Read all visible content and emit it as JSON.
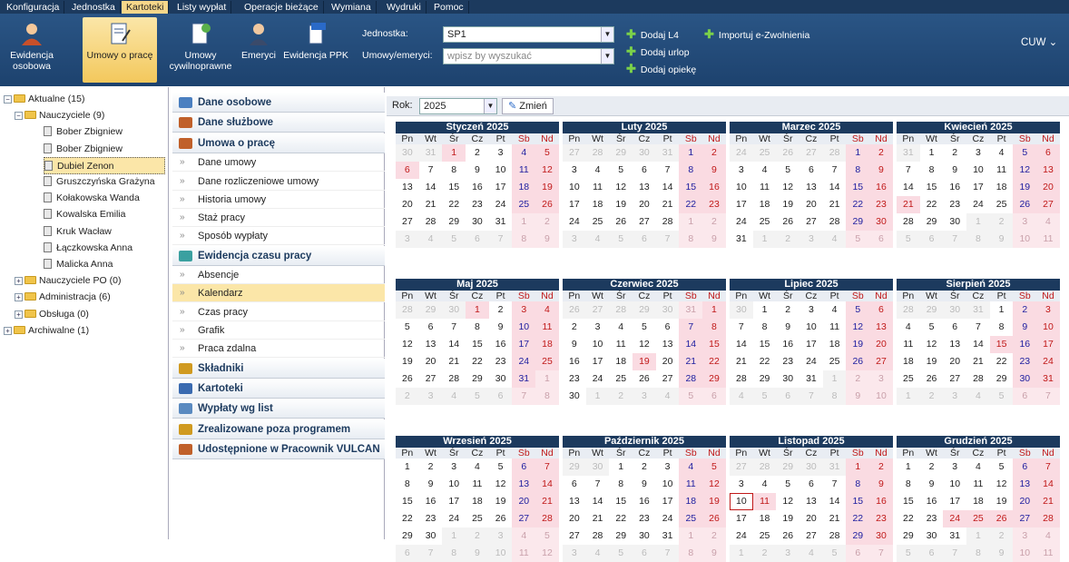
{
  "menu": [
    "Konfiguracja",
    "Jednostka",
    "Kartoteki",
    "Listy wypłat",
    "Operacje bieżące",
    "Wymiana",
    "Wydruki",
    "Pomoc"
  ],
  "menu_active": "Kartoteki",
  "toolbar": {
    "buttons": [
      {
        "label": "Ewidencja\nosobowa",
        "icon": "person-icon"
      },
      {
        "label": "Umowy o pracę",
        "icon": "contract-icon"
      },
      {
        "label": "Umowy\ncywilnoprawne",
        "icon": "civil-contract-icon"
      },
      {
        "label": "Emeryci",
        "icon": "retiree-icon"
      },
      {
        "label": "Ewidencja PPK",
        "icon": "ppk-icon"
      }
    ],
    "jednostka_label": "Jednostka:",
    "jednostka_value": "SP1",
    "umowy_label": "Umowy/emeryci:",
    "umowy_placeholder": "wpisz by wyszukać",
    "actions": [
      "Dodaj L4",
      "Dodaj urlop",
      "Dodaj opiekę",
      "Importuj e-Zwolnienia"
    ],
    "user_menu": "CUW"
  },
  "tree": [
    {
      "label": "Aktualne (15)",
      "type": "folder",
      "level": 0,
      "expander": "-"
    },
    {
      "label": "Nauczyciele (9)",
      "type": "folder",
      "level": 1,
      "expander": "-"
    },
    {
      "label": "Bober Zbigniew",
      "type": "doc",
      "level": 2
    },
    {
      "label": "Bober Zbigniew",
      "type": "doc",
      "level": 2
    },
    {
      "label": "Dubiel Zenon",
      "type": "doc",
      "level": 2,
      "selected": true
    },
    {
      "label": "Gruszczyńska Grażyna",
      "type": "doc",
      "level": 2
    },
    {
      "label": "Kołakowska Wanda",
      "type": "doc",
      "level": 2
    },
    {
      "label": "Kowalska Emilia",
      "type": "doc",
      "level": 2
    },
    {
      "label": "Kruk Wacław",
      "type": "doc",
      "level": 2
    },
    {
      "label": "Łączkowska Anna",
      "type": "doc",
      "level": 2
    },
    {
      "label": "Malicka Anna",
      "type": "doc",
      "level": 2
    },
    {
      "label": "Nauczyciele PO (0)",
      "type": "folder",
      "level": 1,
      "expander": "+"
    },
    {
      "label": "Administracja (6)",
      "type": "folder",
      "level": 1,
      "expander": "+"
    },
    {
      "label": "Obsługa (0)",
      "type": "folder",
      "level": 1,
      "expander": "+"
    },
    {
      "label": "Archiwalne (1)",
      "type": "folder",
      "level": 0,
      "expander": "+"
    }
  ],
  "nav": [
    {
      "label": "Dane osobowe",
      "kind": "section",
      "icon": "person-icon",
      "color": "#4a7fc0"
    },
    {
      "label": "Dane służbowe",
      "kind": "section",
      "icon": "briefcase-icon",
      "color": "#c0602a"
    },
    {
      "label": "Umowa o pracę",
      "kind": "section",
      "icon": "handshake-icon",
      "color": "#c0602a"
    },
    {
      "label": "Dane umowy",
      "kind": "item"
    },
    {
      "label": "Dane rozliczeniowe umowy",
      "kind": "item"
    },
    {
      "label": "Historia umowy",
      "kind": "item"
    },
    {
      "label": "Staż pracy",
      "kind": "item"
    },
    {
      "label": "Sposób wypłaty",
      "kind": "item"
    },
    {
      "label": "Ewidencja czasu pracy",
      "kind": "section",
      "icon": "clock-icon",
      "color": "#3aa0a0"
    },
    {
      "label": "Absencje",
      "kind": "item"
    },
    {
      "label": "Kalendarz",
      "kind": "item",
      "active": true
    },
    {
      "label": "Czas pracy",
      "kind": "item"
    },
    {
      "label": "Grafik",
      "kind": "item"
    },
    {
      "label": "Praca zdalna",
      "kind": "item"
    },
    {
      "label": "Składniki",
      "kind": "section",
      "icon": "components-icon",
      "color": "#d09a20"
    },
    {
      "label": "Kartoteki",
      "kind": "section",
      "icon": "card-icon",
      "color": "#3a6ab0"
    },
    {
      "label": "Wypłaty wg list",
      "kind": "section",
      "icon": "payout-icon",
      "color": "#5a8ac0"
    },
    {
      "label": "Zrealizowane poza programem",
      "kind": "section",
      "icon": "external-icon",
      "color": "#d09a20"
    },
    {
      "label": "Udostępnione w Pracownik VULCAN",
      "kind": "section",
      "icon": "share-icon",
      "color": "#c0602a"
    }
  ],
  "year": {
    "label": "Rok:",
    "value": "2025",
    "change_button": "Zmień"
  },
  "weekdays": [
    "Pn",
    "Wt",
    "Śr",
    "Cz",
    "Pt",
    "Sb",
    "Nd"
  ],
  "months": [
    {
      "name": "Styczeń 2025",
      "weeks": [
        [
          "30",
          "31",
          "1",
          "2",
          "3",
          "4",
          "5"
        ],
        [
          "6",
          "7",
          "8",
          "9",
          "10",
          "11",
          "12"
        ],
        [
          "13",
          "14",
          "15",
          "16",
          "17",
          "18",
          "19"
        ],
        [
          "20",
          "21",
          "22",
          "23",
          "24",
          "25",
          "26"
        ],
        [
          "27",
          "28",
          "29",
          "30",
          "31",
          "1",
          "2"
        ],
        [
          "3",
          "4",
          "5",
          "6",
          "7",
          "8",
          "9"
        ]
      ]
    },
    {
      "name": "Luty 2025",
      "weeks": [
        [
          "27",
          "28",
          "29",
          "30",
          "31",
          "1",
          "2"
        ],
        [
          "3",
          "4",
          "5",
          "6",
          "7",
          "8",
          "9"
        ],
        [
          "10",
          "11",
          "12",
          "13",
          "14",
          "15",
          "16"
        ],
        [
          "17",
          "18",
          "19",
          "20",
          "21",
          "22",
          "23"
        ],
        [
          "24",
          "25",
          "26",
          "27",
          "28",
          "1",
          "2"
        ],
        [
          "3",
          "4",
          "5",
          "6",
          "7",
          "8",
          "9"
        ]
      ]
    },
    {
      "name": "Marzec 2025",
      "weeks": [
        [
          "24",
          "25",
          "26",
          "27",
          "28",
          "1",
          "2"
        ],
        [
          "3",
          "4",
          "5",
          "6",
          "7",
          "8",
          "9"
        ],
        [
          "10",
          "11",
          "12",
          "13",
          "14",
          "15",
          "16"
        ],
        [
          "17",
          "18",
          "19",
          "20",
          "21",
          "22",
          "23"
        ],
        [
          "24",
          "25",
          "26",
          "27",
          "28",
          "29",
          "30"
        ],
        [
          "31",
          "1",
          "2",
          "3",
          "4",
          "5",
          "6"
        ]
      ]
    },
    {
      "name": "Kwiecień 2025",
      "weeks": [
        [
          "31",
          "1",
          "2",
          "3",
          "4",
          "5",
          "6"
        ],
        [
          "7",
          "8",
          "9",
          "10",
          "11",
          "12",
          "13"
        ],
        [
          "14",
          "15",
          "16",
          "17",
          "18",
          "19",
          "20"
        ],
        [
          "21",
          "22",
          "23",
          "24",
          "25",
          "26",
          "27"
        ],
        [
          "28",
          "29",
          "30",
          "1",
          "2",
          "3",
          "4"
        ],
        [
          "5",
          "6",
          "7",
          "8",
          "9",
          "10",
          "11"
        ]
      ]
    },
    {
      "name": "Maj 2025",
      "weeks": [
        [
          "28",
          "29",
          "30",
          "1",
          "2",
          "3",
          "4"
        ],
        [
          "5",
          "6",
          "7",
          "8",
          "9",
          "10",
          "11"
        ],
        [
          "12",
          "13",
          "14",
          "15",
          "16",
          "17",
          "18"
        ],
        [
          "19",
          "20",
          "21",
          "22",
          "23",
          "24",
          "25"
        ],
        [
          "26",
          "27",
          "28",
          "29",
          "30",
          "31",
          "1"
        ],
        [
          "2",
          "3",
          "4",
          "5",
          "6",
          "7",
          "8"
        ]
      ]
    },
    {
      "name": "Czerwiec 2025",
      "weeks": [
        [
          "26",
          "27",
          "28",
          "29",
          "30",
          "31",
          "1"
        ],
        [
          "2",
          "3",
          "4",
          "5",
          "6",
          "7",
          "8"
        ],
        [
          "9",
          "10",
          "11",
          "12",
          "13",
          "14",
          "15"
        ],
        [
          "16",
          "17",
          "18",
          "19",
          "20",
          "21",
          "22"
        ],
        [
          "23",
          "24",
          "25",
          "26",
          "27",
          "28",
          "29"
        ],
        [
          "30",
          "1",
          "2",
          "3",
          "4",
          "5",
          "6"
        ]
      ]
    },
    {
      "name": "Lipiec 2025",
      "weeks": [
        [
          "30",
          "1",
          "2",
          "3",
          "4",
          "5",
          "6"
        ],
        [
          "7",
          "8",
          "9",
          "10",
          "11",
          "12",
          "13"
        ],
        [
          "14",
          "15",
          "16",
          "17",
          "18",
          "19",
          "20"
        ],
        [
          "21",
          "22",
          "23",
          "24",
          "25",
          "26",
          "27"
        ],
        [
          "28",
          "29",
          "30",
          "31",
          "1",
          "2",
          "3"
        ],
        [
          "4",
          "5",
          "6",
          "7",
          "8",
          "9",
          "10"
        ]
      ]
    },
    {
      "name": "Sierpień 2025",
      "weeks": [
        [
          "28",
          "29",
          "30",
          "31",
          "1",
          "2",
          "3"
        ],
        [
          "4",
          "5",
          "6",
          "7",
          "8",
          "9",
          "10"
        ],
        [
          "11",
          "12",
          "13",
          "14",
          "15",
          "16",
          "17"
        ],
        [
          "18",
          "19",
          "20",
          "21",
          "22",
          "23",
          "24"
        ],
        [
          "25",
          "26",
          "27",
          "28",
          "29",
          "30",
          "31"
        ],
        [
          "1",
          "2",
          "3",
          "4",
          "5",
          "6",
          "7"
        ]
      ]
    },
    {
      "name": "Wrzesień 2025",
      "weeks": [
        [
          "1",
          "2",
          "3",
          "4",
          "5",
          "6",
          "7"
        ],
        [
          "8",
          "9",
          "10",
          "11",
          "12",
          "13",
          "14"
        ],
        [
          "15",
          "16",
          "17",
          "18",
          "19",
          "20",
          "21"
        ],
        [
          "22",
          "23",
          "24",
          "25",
          "26",
          "27",
          "28"
        ],
        [
          "29",
          "30",
          "1",
          "2",
          "3",
          "4",
          "5"
        ],
        [
          "6",
          "7",
          "8",
          "9",
          "10",
          "11",
          "12"
        ]
      ]
    },
    {
      "name": "Październik 2025",
      "weeks": [
        [
          "29",
          "30",
          "1",
          "2",
          "3",
          "4",
          "5"
        ],
        [
          "6",
          "7",
          "8",
          "9",
          "10",
          "11",
          "12"
        ],
        [
          "13",
          "14",
          "15",
          "16",
          "17",
          "18",
          "19"
        ],
        [
          "20",
          "21",
          "22",
          "23",
          "24",
          "25",
          "26"
        ],
        [
          "27",
          "28",
          "29",
          "30",
          "31",
          "1",
          "2"
        ],
        [
          "3",
          "4",
          "5",
          "6",
          "7",
          "8",
          "9"
        ]
      ]
    },
    {
      "name": "Listopad 2025",
      "weeks": [
        [
          "27",
          "28",
          "29",
          "30",
          "31",
          "1",
          "2"
        ],
        [
          "3",
          "4",
          "5",
          "6",
          "7",
          "8",
          "9"
        ],
        [
          "10",
          "11",
          "12",
          "13",
          "14",
          "15",
          "16"
        ],
        [
          "17",
          "18",
          "19",
          "20",
          "21",
          "22",
          "23"
        ],
        [
          "24",
          "25",
          "26",
          "27",
          "28",
          "29",
          "30"
        ],
        [
          "1",
          "2",
          "3",
          "4",
          "5",
          "6",
          "7"
        ]
      ]
    },
    {
      "name": "Grudzień 2025",
      "weeks": [
        [
          "1",
          "2",
          "3",
          "4",
          "5",
          "6",
          "7"
        ],
        [
          "8",
          "9",
          "10",
          "11",
          "12",
          "13",
          "14"
        ],
        [
          "15",
          "16",
          "17",
          "18",
          "19",
          "20",
          "21"
        ],
        [
          "22",
          "23",
          "24",
          "25",
          "26",
          "27",
          "28"
        ],
        [
          "29",
          "30",
          "31",
          "1",
          "2",
          "3",
          "4"
        ],
        [
          "5",
          "6",
          "7",
          "8",
          "9",
          "10",
          "11"
        ]
      ]
    }
  ],
  "month_first_week_offset": [
    2,
    5,
    5,
    1,
    3,
    6,
    1,
    4,
    0,
    2,
    5,
    0
  ],
  "month_lengths": [
    31,
    28,
    31,
    30,
    31,
    30,
    31,
    31,
    30,
    31,
    30,
    31
  ],
  "holidays": [
    [
      1,
      1
    ],
    [
      1,
      6
    ],
    [
      4,
      20
    ],
    [
      4,
      21
    ],
    [
      5,
      1
    ],
    [
      5,
      3
    ],
    [
      6,
      8
    ],
    [
      6,
      19
    ],
    [
      8,
      15
    ],
    [
      11,
      1
    ],
    [
      11,
      11
    ],
    [
      12,
      24
    ],
    [
      12,
      25
    ],
    [
      12,
      26
    ]
  ],
  "today": [
    11,
    10
  ]
}
